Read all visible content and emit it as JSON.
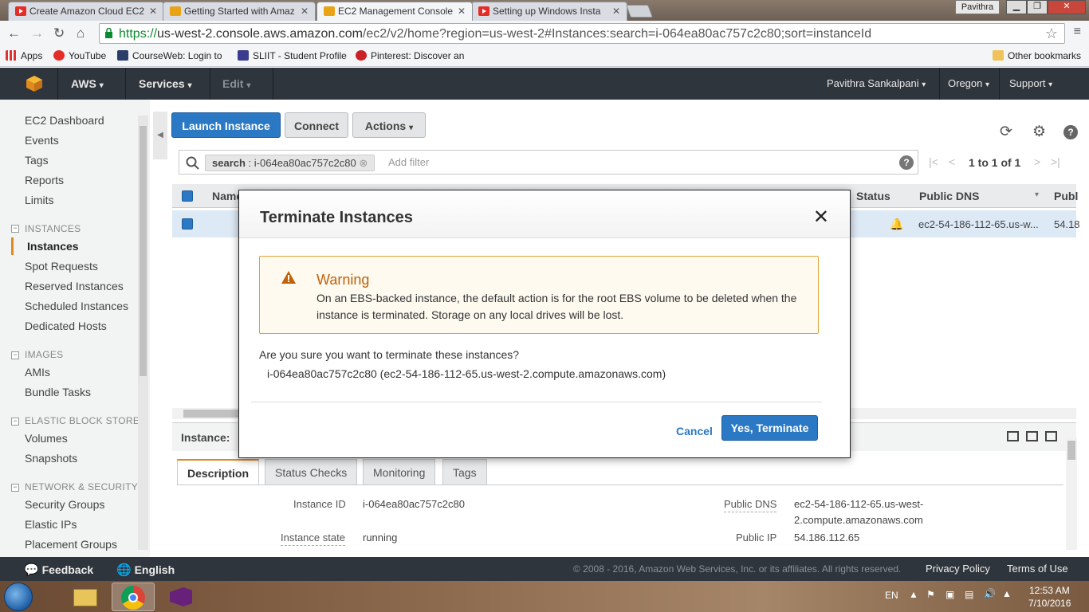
{
  "browser": {
    "tabs": [
      {
        "title": "Create Amazon Cloud EC2",
        "favicon": "youtube-icon",
        "active": false
      },
      {
        "title": "Getting Started with Amaz",
        "favicon": "aws-icon",
        "active": false
      },
      {
        "title": "EC2 Management Console",
        "favicon": "aws-icon",
        "active": true
      },
      {
        "title": "Setting up Windows Insta",
        "favicon": "youtube-icon",
        "active": false
      }
    ],
    "profile": "Pavithra",
    "url_scheme": "https://",
    "url_host": "us-west-2.console.aws.amazon.com",
    "url_rest": "/ec2/v2/home?region=us-west-2#Instances:search=i-064ea80ac757c2c80;sort=instanceId",
    "bookmarks": [
      "Apps",
      "YouTube",
      "CourseWeb: Login to",
      "SLIIT - Student Profile",
      "Pinterest: Discover an"
    ],
    "other_bookmarks": "Other bookmarks"
  },
  "header": {
    "aws": "AWS",
    "services": "Services",
    "edit": "Edit",
    "user": "Pavithra Sankalpani",
    "region": "Oregon",
    "support": "Support"
  },
  "sidebar": {
    "top_items": [
      "EC2 Dashboard",
      "Events",
      "Tags",
      "Reports",
      "Limits"
    ],
    "sections": [
      {
        "heading": "INSTANCES",
        "items": [
          "Instances",
          "Spot Requests",
          "Reserved Instances",
          "Scheduled Instances",
          "Dedicated Hosts"
        ]
      },
      {
        "heading": "IMAGES",
        "items": [
          "AMIs",
          "Bundle Tasks"
        ]
      },
      {
        "heading": "ELASTIC BLOCK STORE",
        "items": [
          "Volumes",
          "Snapshots"
        ]
      },
      {
        "heading": "NETWORK & SECURITY",
        "items": [
          "Security Groups",
          "Elastic IPs",
          "Placement Groups"
        ]
      }
    ],
    "active_item": "Instances"
  },
  "toolbar": {
    "launch": "Launch Instance",
    "connect": "Connect",
    "actions": "Actions"
  },
  "filter": {
    "chip_key": "search",
    "chip_sep": ":",
    "chip_value": "i-064ea80ac757c2c80",
    "placeholder": "Add filter",
    "pagination": "1 to 1 of 1"
  },
  "table": {
    "col_name": "Name",
    "col_status": "Status",
    "col_dns": "Public DNS",
    "col_ip": "Publ",
    "row_dns": "ec2-54-186-112-65.us-w...",
    "row_ip": "54.18"
  },
  "details": {
    "instance_label": "Instance:",
    "tabs": [
      "Description",
      "Status Checks",
      "Monitoring",
      "Tags"
    ],
    "instance_id_label": "Instance ID",
    "instance_id": "i-064ea80ac757c2c80",
    "instance_state_label": "Instance state",
    "instance_state": "running",
    "public_dns_label": "Public DNS",
    "public_dns_line1": "ec2-54-186-112-65.us-west-",
    "public_dns_line2": "2.compute.amazonaws.com",
    "public_ip_label": "Public IP",
    "public_ip": "54.186.112.65"
  },
  "modal": {
    "title": "Terminate Instances",
    "warning_title": "Warning",
    "warning_text": "On an EBS-backed instance, the default action is for the root EBS volume to be deleted when the instance is terminated. Storage on any local drives will be lost.",
    "question": "Are you sure you want to terminate these instances?",
    "instance_line": "i-064ea80ac757c2c80 (ec2-54-186-112-65.us-west-2.compute.amazonaws.com)",
    "cancel": "Cancel",
    "confirm": "Yes, Terminate"
  },
  "footer": {
    "feedback": "Feedback",
    "language": "English",
    "copyright": "© 2008 - 2016, Amazon Web Services, Inc. or its affiliates. All rights reserved.",
    "privacy": "Privacy Policy",
    "terms": "Terms of Use"
  },
  "taskbar": {
    "lang": "EN",
    "time": "12:53 AM",
    "date": "7/10/2016"
  },
  "colors": {
    "aws_header": "#2f353c",
    "primary_button": "#2b78c5",
    "warning_accent": "#e0a33a",
    "active_accent": "#e08a1e"
  }
}
